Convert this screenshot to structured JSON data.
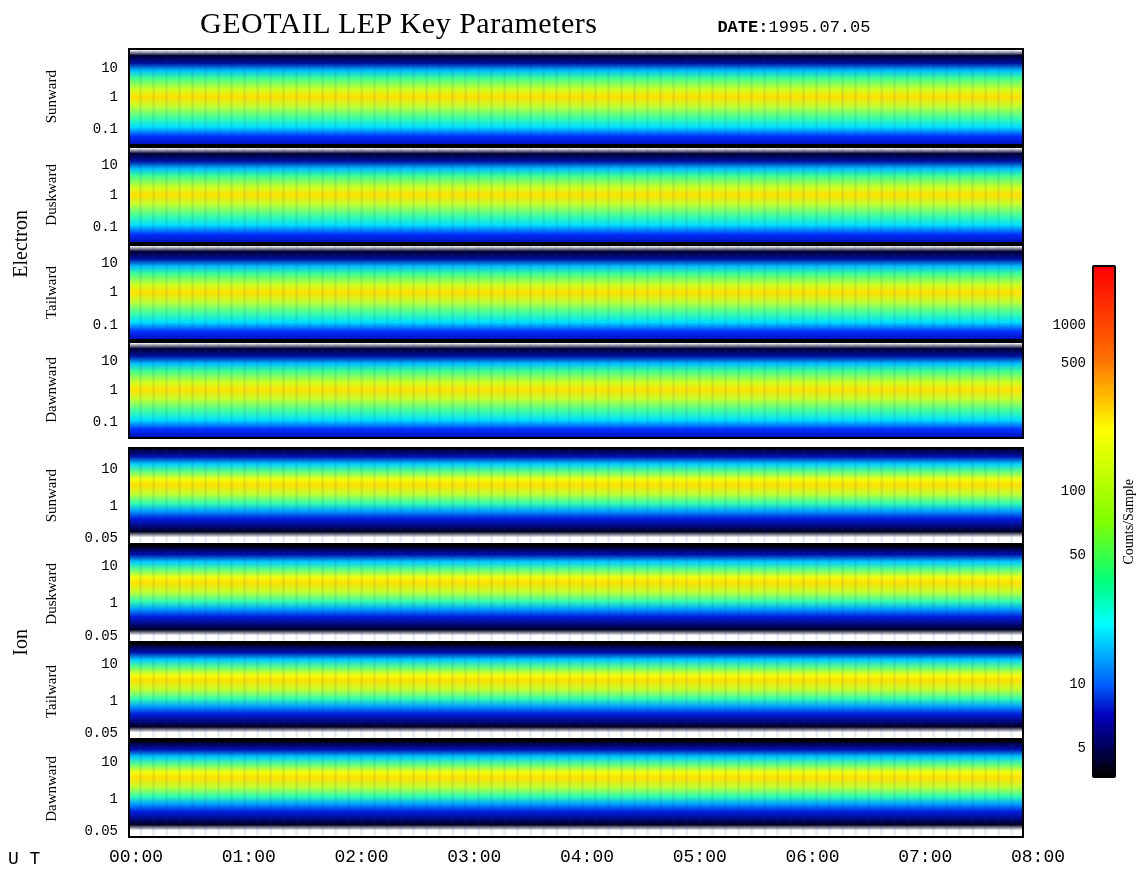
{
  "title": "GEOTAIL LEP Key Parameters",
  "date": {
    "label": "DATE:",
    "value": "1995.07.05"
  },
  "groups": [
    {
      "kind": "electron",
      "name": "Electron",
      "panels": [
        {
          "label": "Sunward",
          "yticks": [
            "10",
            "1",
            "0.1"
          ]
        },
        {
          "label": "Duskward",
          "yticks": [
            "10",
            "1",
            "0.1"
          ]
        },
        {
          "label": "Tailward",
          "yticks": [
            "10",
            "1",
            "0.1"
          ]
        },
        {
          "label": "Dawnward",
          "yticks": [
            "10",
            "1",
            "0.1"
          ]
        }
      ]
    },
    {
      "kind": "ion",
      "name": "Ion",
      "panels": [
        {
          "label": "Sunward",
          "yticks": [
            "10",
            "1",
            "0.05"
          ]
        },
        {
          "label": "Duskward",
          "yticks": [
            "10",
            "1",
            "0.05"
          ]
        },
        {
          "label": "Tailward",
          "yticks": [
            "10",
            "1",
            "0.05"
          ]
        },
        {
          "label": "Dawnward",
          "yticks": [
            "10",
            "1",
            "0.05"
          ]
        }
      ]
    }
  ],
  "x_axis": {
    "label": "U T",
    "ticks": [
      "00:00",
      "01:00",
      "02:00",
      "03:00",
      "04:00",
      "05:00",
      "06:00",
      "07:00",
      "08:00"
    ]
  },
  "colorbar": {
    "label": "Counts/Sample",
    "ticks": [
      "1000",
      "500",
      "100",
      "50",
      "10",
      "5"
    ]
  }
}
